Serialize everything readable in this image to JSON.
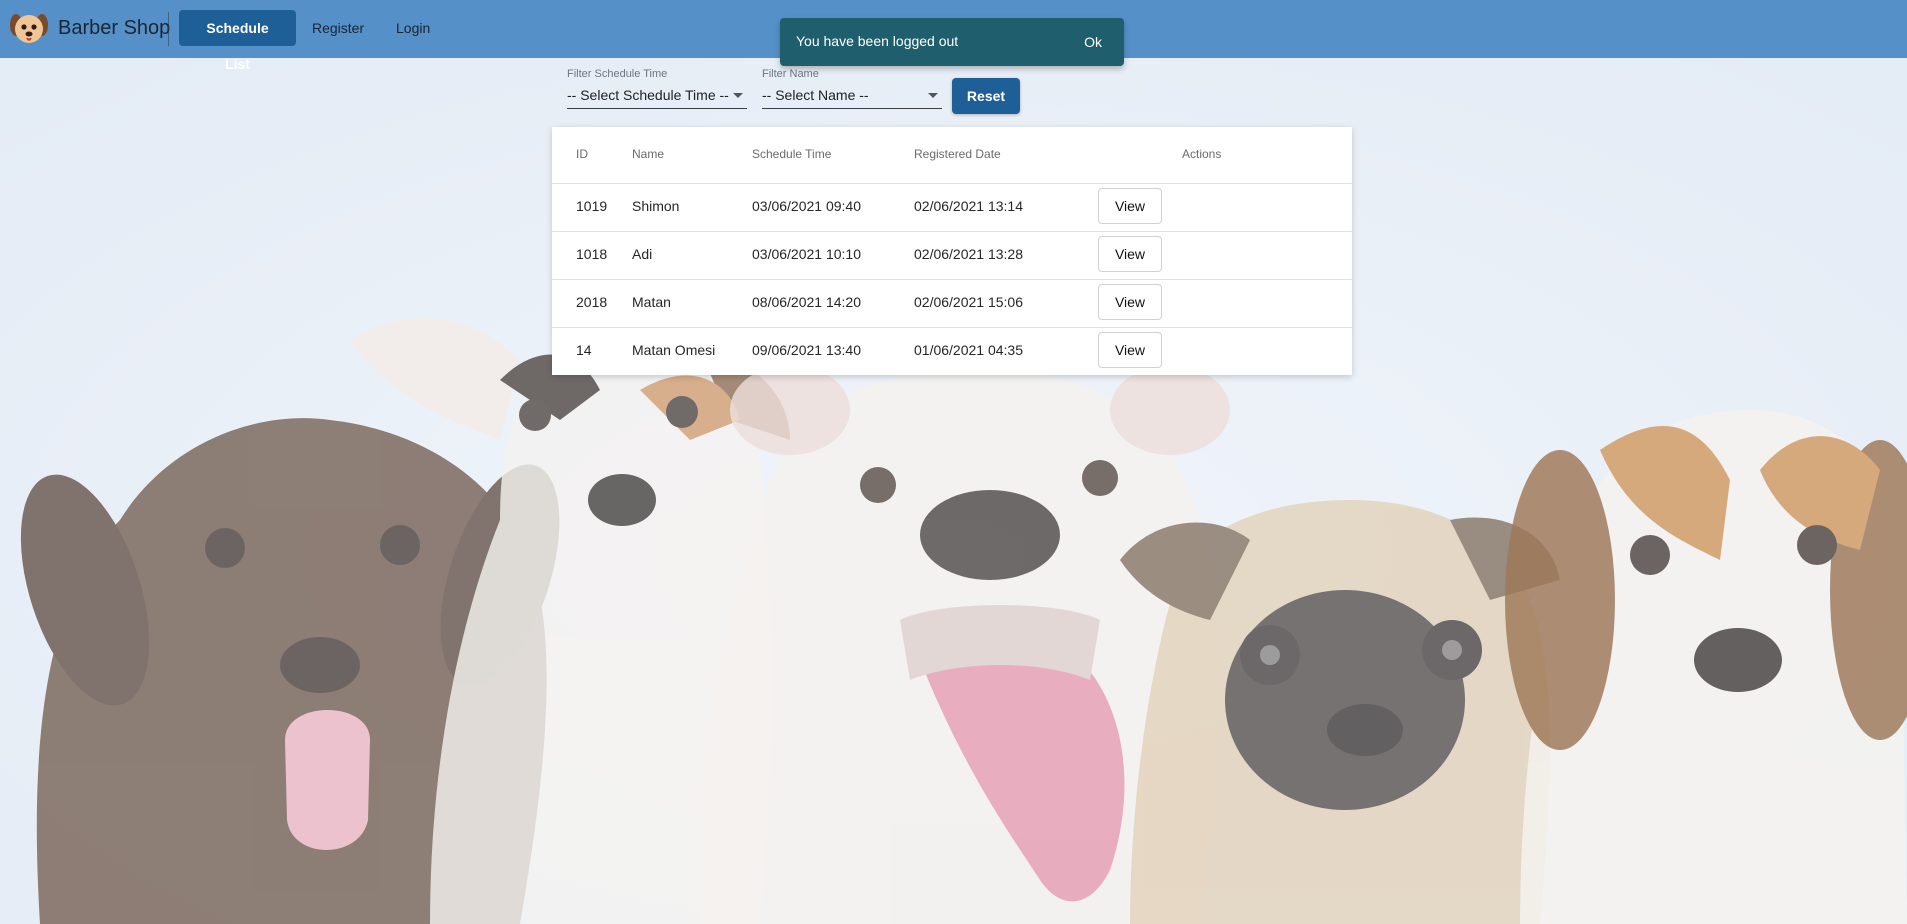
{
  "navbar": {
    "brand": "Barber Shop",
    "items": [
      {
        "label": "Schedule List",
        "active": true
      },
      {
        "label": "Register",
        "active": false
      },
      {
        "label": "Login",
        "active": false
      }
    ],
    "color": "#5590c8",
    "active_color": "#1f5f97"
  },
  "snackbar": {
    "message": "You have been logged out",
    "action": "Ok",
    "color": "#1f5f6d"
  },
  "filters": {
    "schedule_time": {
      "label": "Filter Schedule Time",
      "value": "-- Select Schedule Time --"
    },
    "name": {
      "label": "Filter Name",
      "value": "-- Select Name --"
    },
    "reset_label": "Reset"
  },
  "table": {
    "columns": [
      "ID",
      "Name",
      "Schedule Time",
      "Registered Date",
      "Actions"
    ],
    "rows": [
      {
        "id": "1019",
        "name": "Shimon",
        "schedule_time": "03/06/2021 09:40",
        "registered": "02/06/2021 13:14",
        "action": "View"
      },
      {
        "id": "1018",
        "name": "Adi",
        "schedule_time": "03/06/2021 10:10",
        "registered": "02/06/2021 13:28",
        "action": "View"
      },
      {
        "id": "2018",
        "name": "Matan",
        "schedule_time": "08/06/2021 14:20",
        "registered": "02/06/2021 15:06",
        "action": "View"
      },
      {
        "id": "14",
        "name": "Matan Omesi",
        "schedule_time": "09/06/2021 13:40",
        "registered": "01/06/2021 04:35",
        "action": "View"
      }
    ]
  },
  "background": {
    "image": "puppies-photo",
    "base_color": "#e7eef8"
  }
}
